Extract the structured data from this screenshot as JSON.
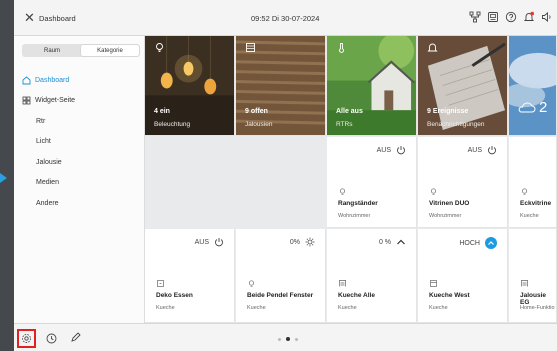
{
  "header": {
    "title": "Dashboard",
    "datetime": "09:52  Di 30-07-2024"
  },
  "sidebar": {
    "segments": [
      "Raum",
      "Kategorie"
    ],
    "active_segment": "Kategorie",
    "items": [
      {
        "label": "Dashboard",
        "icon": "home-icon"
      },
      {
        "label": "Widget-Seite",
        "icon": "grid-icon"
      },
      {
        "label": "Rtr"
      },
      {
        "label": "Licht"
      },
      {
        "label": "Jalousie"
      },
      {
        "label": "Medien"
      },
      {
        "label": "Andere"
      }
    ]
  },
  "summary_tiles": [
    {
      "count": "4 ein",
      "label": "Beleuchtung",
      "icon": "bulb-icon"
    },
    {
      "count": "9 offen",
      "label": "Jalousien",
      "icon": "blind-icon"
    },
    {
      "count": "Alle aus",
      "label": "RTRs",
      "icon": "thermometer-icon"
    },
    {
      "count": "9 Ereignisse",
      "label": "Benachrichtigungen",
      "icon": "bell-icon"
    },
    {
      "temp": "2",
      "icon": "cloud-sun-icon"
    }
  ],
  "row2": [
    {
      "status": "AUS",
      "name": "Rangständer",
      "room": "Wohnzimmer",
      "icon": "lamp-icon"
    },
    {
      "status": "AUS",
      "name": "Vitrinen DUO",
      "room": "Wohnzimmer",
      "icon": "lamp-icon"
    },
    {
      "status": "",
      "name": "Eckvitrine",
      "room": "Kueche",
      "icon": "lamp-icon"
    }
  ],
  "row3": [
    {
      "status": "AUS",
      "name": "Deko Essen",
      "room": "Kueche",
      "icon": "plug-icon"
    },
    {
      "status": "0%",
      "name": "Beide Pendel Fenster",
      "room": "Kueche",
      "icon": "dimmer-icon"
    },
    {
      "status": "0 %",
      "name": "Kueche Alle",
      "room": "Kueche",
      "icon": "blind-icon"
    },
    {
      "status": "HOCH",
      "name": "Kueche West",
      "room": "Kueche",
      "icon": "blind-icon"
    },
    {
      "status": "",
      "name": "Jalousie EG",
      "room": "Home-Funktio",
      "icon": "blind-icon"
    }
  ],
  "colors": {
    "accent": "#1e8fd5",
    "highlight": "#e22222"
  }
}
